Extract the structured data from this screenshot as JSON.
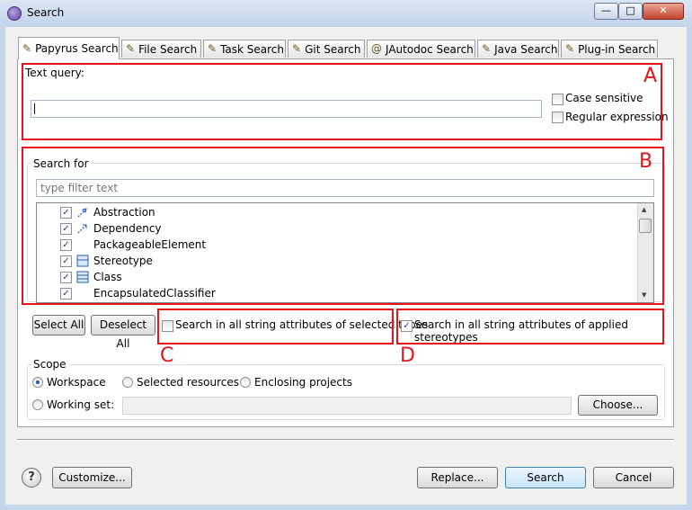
{
  "window": {
    "title": "Search",
    "minimize": "—",
    "maximize": "□",
    "close": "✕"
  },
  "tabs": [
    {
      "label": "Papyrus Search"
    },
    {
      "label": "File Search"
    },
    {
      "label": "Task Search"
    },
    {
      "label": "Git Search"
    },
    {
      "label": "JAutodoc Search"
    },
    {
      "label": "Java Search"
    },
    {
      "label": "Plug-in Search"
    }
  ],
  "query": {
    "label": "Text query:",
    "value": "",
    "case_sensitive": {
      "label": "Case sensitive",
      "checked": false
    },
    "regex": {
      "label": "Regular expression",
      "checked": false
    }
  },
  "search_for": {
    "label": "Search for",
    "filter_placeholder": "type filter text",
    "items": [
      {
        "label": "Abstraction",
        "checked": true,
        "icon": "abstraction-icon"
      },
      {
        "label": "Dependency",
        "checked": true,
        "icon": "dependency-icon"
      },
      {
        "label": "PackageableElement",
        "checked": true,
        "icon": ""
      },
      {
        "label": "Stereotype",
        "checked": true,
        "icon": "stereotype-icon"
      },
      {
        "label": "Class",
        "checked": true,
        "icon": "class-icon"
      },
      {
        "label": "EncapsulatedClassifier",
        "checked": true,
        "icon": ""
      }
    ]
  },
  "buttons": {
    "select_all": "Select All",
    "deselect_all": "Deselect All",
    "customize": "Customize...",
    "replace": "Replace...",
    "search": "Search",
    "cancel": "Cancel",
    "choose": "Choose..."
  },
  "options": {
    "string_attrs_selected": {
      "label": "Search in all string attributes of selected types",
      "checked": false
    },
    "string_attrs_stereotypes": {
      "label": "Search in all string attributes of applied stereotypes",
      "checked": true
    }
  },
  "scope": {
    "label": "Scope",
    "workspace": "Workspace",
    "selected_resources": "Selected resources",
    "enclosing_projects": "Enclosing projects",
    "working_set": "Working set:",
    "selected": "workspace"
  },
  "annotations": {
    "a": "A",
    "b": "B",
    "c": "C",
    "d": "D"
  },
  "colors": {
    "annotation": "#e8141b",
    "accent": "#1d5fb7"
  }
}
